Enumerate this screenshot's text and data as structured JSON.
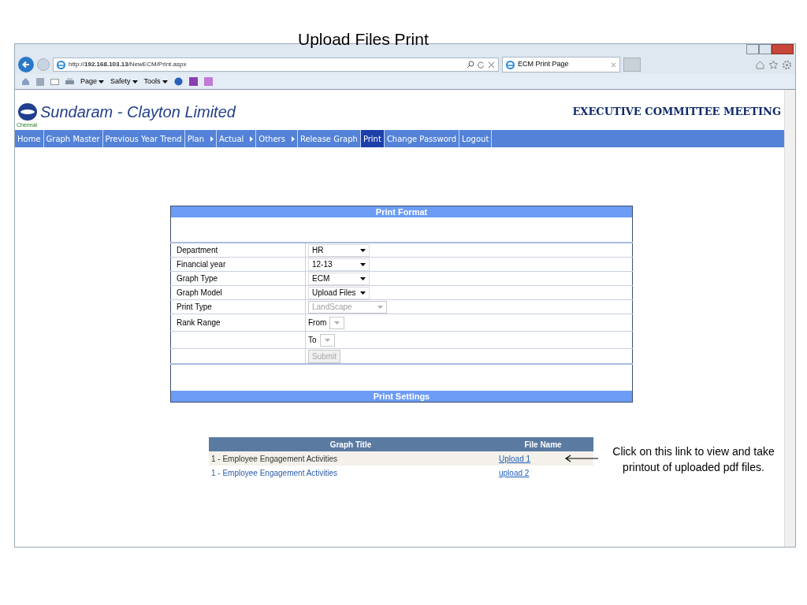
{
  "slide_title": "Upload Files Print",
  "browser": {
    "address": "http://**192.168.103.13**/NewECM/Print.aspx",
    "tab": "ECM Print Page",
    "command_bar": [
      "Page",
      "Safety",
      "Tools"
    ]
  },
  "header": {
    "company": "Sundaram - Clayton Limited",
    "location": "Chennai",
    "meeting": "EXECUTIVE COMMITTEE MEETING"
  },
  "nav": [
    {
      "label": "Home",
      "kind": "link",
      "selected": false
    },
    {
      "label": "Graph Master",
      "kind": "link",
      "selected": false
    },
    {
      "label": "Previous Year Trend",
      "kind": "link",
      "selected": false
    },
    {
      "label": "Plan",
      "kind": "submenu",
      "selected": false
    },
    {
      "label": "Actual",
      "kind": "submenu",
      "selected": false
    },
    {
      "label": "Others",
      "kind": "submenu",
      "selected": false
    },
    {
      "label": "Release Graph",
      "kind": "link",
      "selected": false
    },
    {
      "label": "Print",
      "kind": "link",
      "selected": true
    },
    {
      "label": "Change Password",
      "kind": "link",
      "selected": false
    },
    {
      "label": "Logout",
      "kind": "link",
      "selected": false
    }
  ],
  "print_format": {
    "title": "Print Format",
    "rows": [
      {
        "label": "Department",
        "kind": "select",
        "value": "HR",
        "disabled": false
      },
      {
        "label": "Financial year",
        "kind": "select",
        "value": "12-13",
        "disabled": false
      },
      {
        "label": "Graph Type",
        "kind": "select",
        "value": "ECM",
        "disabled": false
      },
      {
        "label": "Graph Model",
        "kind": "select",
        "value": "Upload Files",
        "disabled": false
      },
      {
        "label": "Print Type",
        "kind": "wide_select",
        "value": "LandScape",
        "disabled": true
      },
      {
        "label": "Rank Range",
        "kind": "range",
        "prefix": "From",
        "disabled": true
      },
      {
        "kind": "range",
        "prefix": "To",
        "disabled": true
      },
      {
        "kind": "button",
        "value": "Submit",
        "disabled": true
      }
    ]
  },
  "print_settings": {
    "title": "Print Settings"
  },
  "files": {
    "columns": [
      "Graph Title",
      "File Name"
    ],
    "rows": [
      {
        "title": "1 - Employee Engagement Activities",
        "file": "Upload 1"
      },
      {
        "title": "1 - Employee Engagement Activities",
        "file": "upload 2"
      }
    ]
  },
  "annotation": "Click on this link to view and take printout of uploaded pdf files."
}
